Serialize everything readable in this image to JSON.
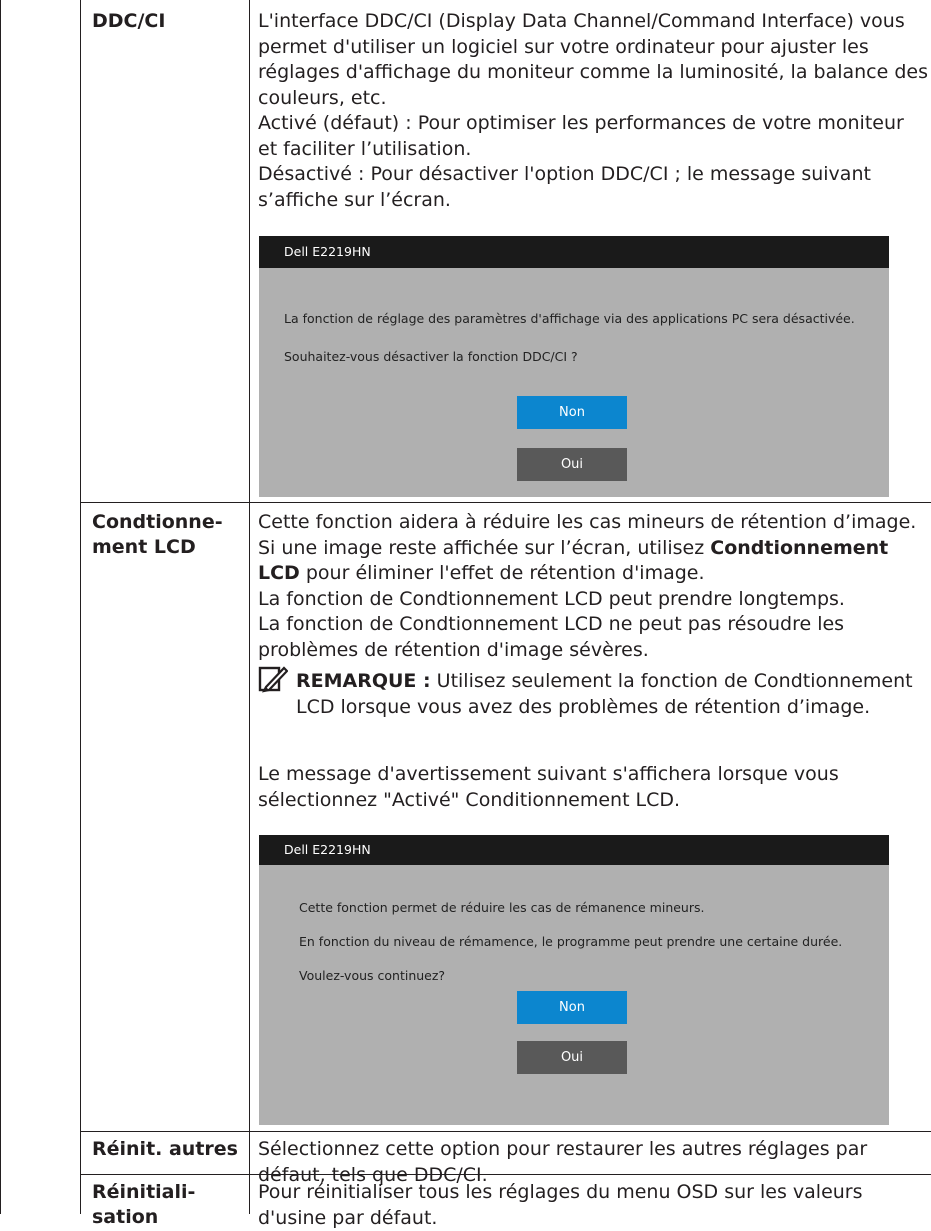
{
  "rows": [
    {
      "label": "DDC/CI",
      "paragraphs": [
        "L'interface DDC/CI (Display Data Channel/Command Interface) vous permet d'utiliser un logiciel sur votre ordinateur pour ajuster les réglages d'affichage du moniteur comme la luminosité, la balance des couleurs, etc.",
        "Activé (défaut) : Pour optimiser les performances de votre moniteur et faciliter l’utilisation.",
        "Désactivé : Pour désactiver l'option DDC/CI ; le message suivant s’affiche sur l’écran."
      ],
      "dialog": {
        "title": "Dell E2219HN",
        "lines": [
          "La fonction de réglage des paramètres d'affichage via des applications PC sera désactivée.",
          "Souhaitez-vous désactiver la fonction DDC/CI ?"
        ],
        "button_non": "Non",
        "button_oui": "Oui"
      }
    },
    {
      "label_line1": "Condtionne-",
      "label_line2": "ment LCD",
      "p1_part1": "Cette fonction aidera à réduire les cas mineurs de rétention d’image. Si une image reste affichée sur l’écran, utilisez ",
      "p1_bold": "Condtionnement LCD",
      "p1_part2": " pour éliminer l'effet de rétention d'image.",
      "p2": "La fonction de Condtionnement LCD peut prendre longtemps.",
      "p3": "La fonction de Condtionnement LCD ne peut pas résoudre les problèmes de rétention d'image sévères.",
      "note_label": "REMARQUE :",
      "note_text": " Utilisez seulement la fonction de Condtionnement LCD lorsque vous avez des problèmes de rétention d’image.",
      "p4": "Le message d'avertissement suivant s'affichera lorsque vous sélectionnez \"Activé\" Conditionnement LCD.",
      "dialog": {
        "title": "Dell E2219HN",
        "lines": [
          "Cette fonction permet de réduire les cas de rémanence mineurs.",
          "En fonction du niveau de rémamence, le programme peut prendre une certaine durée.",
          "Voulez-vous continuez?"
        ],
        "button_non": "Non",
        "button_oui": "Oui"
      }
    },
    {
      "label": "Réinit. autres",
      "text": "Sélectionnez cette option pour restaurer les autres réglages par défaut, tels que DDC/CI."
    },
    {
      "label_line1": "Réinitiali-",
      "label_line2": "sation",
      "text": "Pour réinitialiser tous les réglages du menu OSD sur les valeurs d'usine par défaut."
    }
  ],
  "icons": {
    "note": "pencil-note-icon"
  },
  "colors": {
    "dialog_bg": "#b0b0b0",
    "dialog_title_bg": "#1a1a1a",
    "button_non": "#0c86cf",
    "button_oui": "#595959"
  }
}
